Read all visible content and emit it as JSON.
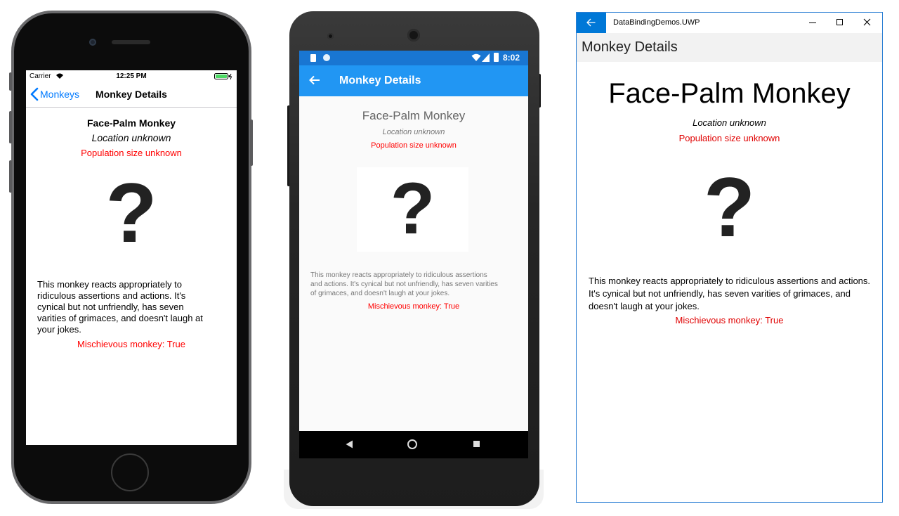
{
  "ios": {
    "carrier": "Carrier",
    "time": "12:25 PM",
    "back_label": "Monkeys",
    "nav_title": "Monkey Details",
    "name": "Face-Palm Monkey",
    "location": "Location unknown",
    "population": "Population size unknown",
    "image_glyph": "?",
    "description_lines": [
      "This monkey reacts appropriately to",
      "ridiculous assertions and actions. It's",
      "cynical but not unfriendly, has seven",
      "varities of grimaces, and doesn't laugh at",
      "your jokes."
    ],
    "mischievous": "Mischievous monkey: True"
  },
  "android": {
    "time": "8:02",
    "nav_title": "Monkey Details",
    "name": "Face-Palm Monkey",
    "location": "Location unknown",
    "population": "Population size unknown",
    "image_glyph": "?",
    "description_lines": [
      "This monkey reacts appropriately to ridiculous assertions",
      "and actions. It's cynical but not unfriendly, has seven varities",
      "of grimaces, and doesn't laugh at your jokes."
    ],
    "mischievous": "Mischievous monkey: True"
  },
  "uwp": {
    "window_title": "DataBindingDemos.UWP",
    "page_title": "Monkey Details",
    "name": "Face-Palm Monkey",
    "location": "Location unknown",
    "population": "Population size unknown",
    "image_glyph": "?",
    "description_lines": [
      "This monkey reacts appropriately to ridiculous assertions and actions.",
      "It's cynical but not unfriendly, has seven varities of grimaces, and",
      "doesn't laugh at your jokes."
    ],
    "mischievous": "Mischievous monkey: True"
  },
  "colors": {
    "ios_accent": "#007aff",
    "android_primary": "#2196f3",
    "android_primary_dark": "#1976d2",
    "uwp_accent": "#0078d7",
    "red": "#ff0000"
  },
  "icons": {
    "ios_back": "chevron-left-icon",
    "android_back": "arrow-left-icon",
    "uwp_back": "arrow-left-icon",
    "uwp_minimize": "minimize-icon",
    "uwp_maximize": "maximize-icon",
    "uwp_close": "close-icon"
  }
}
